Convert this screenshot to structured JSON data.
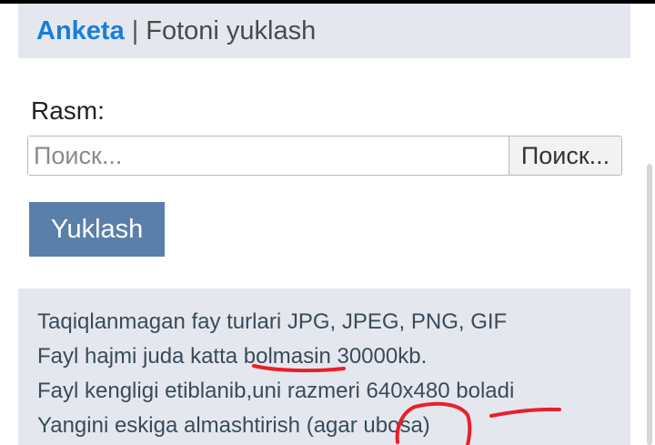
{
  "header": {
    "active_tab": "Anketa",
    "separator": "|",
    "link_tab": "Fotoni yuklash"
  },
  "form": {
    "field_label": "Rasm:",
    "file_input_placeholder": "Поиск...",
    "browse_label": "Поиск...",
    "submit_label": "Yuklash"
  },
  "info": {
    "lines": [
      "Taqiqlanmagan fay turlari JPG, JPEG, PNG, GIF",
      "Fayl hajmi juda katta bolmasin 30000kb.",
      "Fayl kengligi etiblanib,uni razmeri 640x480 boladi",
      "Yangini eskiga almashtirish (agar ubosa)"
    ]
  },
  "colors": {
    "accent": "#1a7ed8",
    "button": "#5a7fa8",
    "panel": "#e4e8ee",
    "annotation": "#e8202a"
  }
}
